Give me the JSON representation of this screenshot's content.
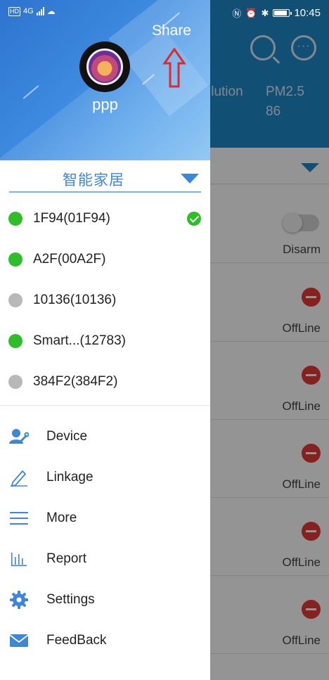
{
  "status_bar": {
    "left": {
      "hd": "HD",
      "network": "4G"
    },
    "time": "10:45"
  },
  "background": {
    "header_partial_label": "llution",
    "pm_label": "PM2.5",
    "pm_value": "86",
    "rows": [
      {
        "status": "Disarm",
        "kind": "toggle"
      },
      {
        "status": "OffLine",
        "kind": "remove"
      },
      {
        "status": "OffLine",
        "kind": "remove"
      },
      {
        "status": "OffLine",
        "kind": "remove"
      },
      {
        "status": "OffLine",
        "kind": "remove"
      },
      {
        "status": "OffLine",
        "kind": "remove"
      }
    ]
  },
  "drawer": {
    "share_label": "Share",
    "username": "ppp",
    "home_label": "智能家居",
    "devices": [
      {
        "name": "1F94(01F94)",
        "online": true,
        "selected": true
      },
      {
        "name": "A2F(00A2F)",
        "online": true,
        "selected": false
      },
      {
        "name": "10136(10136)",
        "online": false,
        "selected": false
      },
      {
        "name": "Smart...(12783)",
        "online": true,
        "selected": false
      },
      {
        "name": "384F2(384F2)",
        "online": false,
        "selected": false
      }
    ],
    "menu": [
      {
        "label": "Device",
        "icon": "device-icon"
      },
      {
        "label": "Linkage",
        "icon": "pencil-icon"
      },
      {
        "label": "More",
        "icon": "menu-lines-icon"
      },
      {
        "label": "Report",
        "icon": "bar-chart-icon"
      },
      {
        "label": "Settings",
        "icon": "gear-icon"
      },
      {
        "label": "FeedBack",
        "icon": "mail-icon"
      }
    ]
  },
  "colors": {
    "accent": "#3d86d9",
    "online": "#2dbe2a",
    "offline": "#b8b8b8",
    "alert": "#e53935",
    "annotation": "#e0282e"
  }
}
